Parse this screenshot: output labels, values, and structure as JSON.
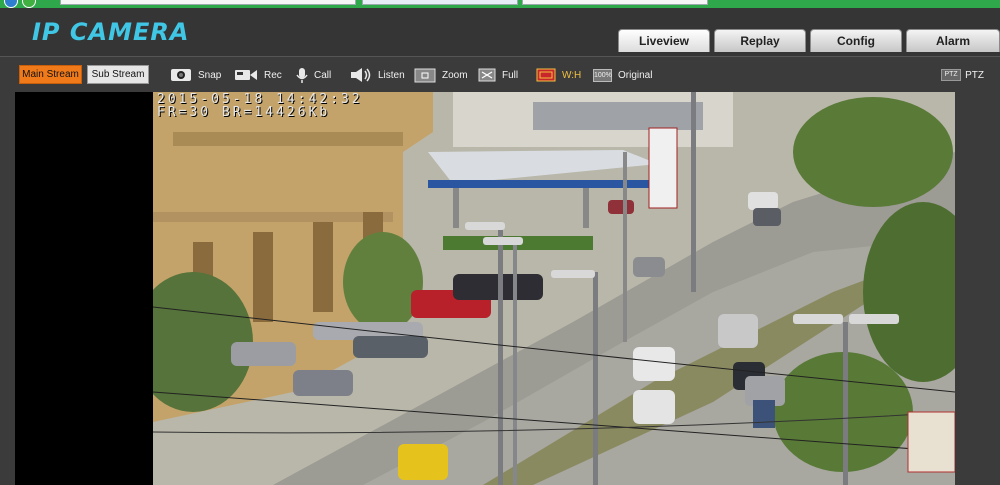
{
  "brand": "IP CAMERA",
  "tabs": [
    {
      "label": "Liveview",
      "active": true
    },
    {
      "label": "Replay"
    },
    {
      "label": "Config"
    },
    {
      "label": "Alarm"
    }
  ],
  "toolbar": {
    "main_stream": "Main Stream",
    "sub_stream": "Sub Stream",
    "snap": "Snap",
    "rec": "Rec",
    "call": "Call",
    "listen": "Listen",
    "zoom": "Zoom",
    "full": "Full",
    "wh": "W:H",
    "original": "Original",
    "ptz": "PTZ",
    "ptz_icon": "PTZ",
    "original_icon": "100%"
  },
  "video": {
    "timestamp": "2015-05-18 14:42:32",
    "stats": "FR=30 BR=14426Kb"
  },
  "colors": {
    "accent": "#41c7e6",
    "main_stream_bg": "#f07a1a",
    "toolbar_bg": "#3b3b3b"
  }
}
